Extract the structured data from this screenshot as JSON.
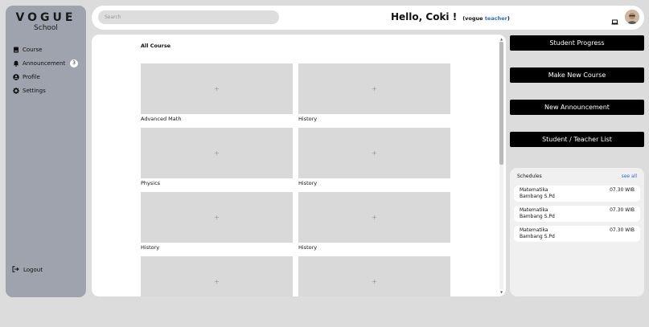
{
  "brand": {
    "name": "VOGUE",
    "subtitle": "School"
  },
  "sidebar": {
    "items": [
      {
        "label": "Course",
        "icon": "book-icon"
      },
      {
        "label": "Announcement",
        "icon": "bell-icon",
        "badge": "3"
      },
      {
        "label": "Profile",
        "icon": "user-circle-icon"
      },
      {
        "label": "Settings",
        "icon": "gear-icon"
      }
    ],
    "logout": "Logout"
  },
  "header": {
    "search_placeholder": "Search",
    "greeting": "Hello, Coki !",
    "role_prefix": "(vogue ",
    "role": "teacher",
    "role_suffix": ")"
  },
  "main": {
    "title": "All Course",
    "courses": [
      {
        "label": "Advanced Math",
        "thumb": "+"
      },
      {
        "label": "History",
        "thumb": "+"
      },
      {
        "label": "Physics",
        "thumb": "+"
      },
      {
        "label": "History",
        "thumb": "+"
      },
      {
        "label": "History",
        "thumb": "+"
      },
      {
        "label": "History",
        "thumb": "+"
      },
      {
        "label": "",
        "thumb": "+"
      },
      {
        "label": "",
        "thumb": "+"
      }
    ]
  },
  "actions": {
    "student_progress": "Student Progress",
    "new_course": "Make New Course",
    "new_announcement": "New Announcement",
    "student_teacher_list": "Student / Teacher List"
  },
  "schedules": {
    "title": "Schedules",
    "see_all": "see all",
    "items": [
      {
        "subject": "Matematika",
        "teacher": "Bambang S.Pd",
        "time": "07.30 WIB"
      },
      {
        "subject": "Matematika",
        "teacher": "Bambang S.Pd",
        "time": "07.30 WIB"
      },
      {
        "subject": "Matematika",
        "teacher": "Bambang S.Pd",
        "time": "07.30 WIB"
      }
    ]
  },
  "colors": {
    "sidebar": "#9ea3ad",
    "accent": "#2d6ad8",
    "button": "#000000",
    "page": "#dcdcdc"
  }
}
